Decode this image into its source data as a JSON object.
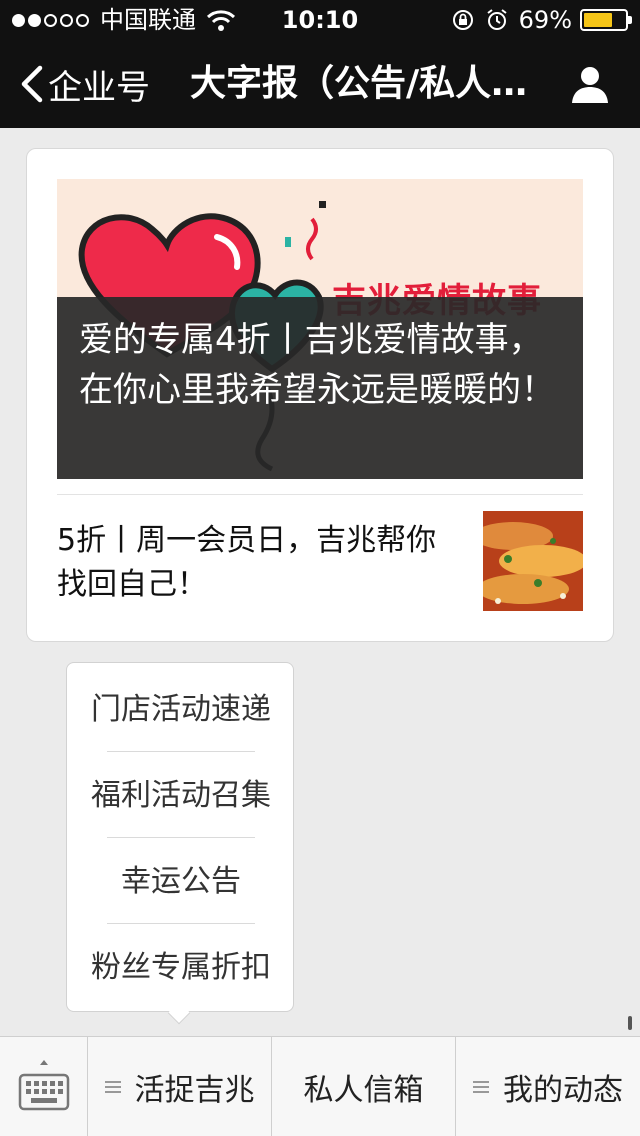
{
  "status_bar": {
    "carrier": "中国联通",
    "time": "10:10",
    "battery_percent_label": "69%",
    "battery_level": 0.69,
    "signal_bars_on": 2,
    "signal_bars_total": 5
  },
  "nav": {
    "back_label": "企业号",
    "title": "大字报（公告/私人…",
    "icons": {
      "back": "chevron-left-icon",
      "profile": "person-icon"
    }
  },
  "card": {
    "hero_brand": "吉兆爱情故事",
    "hero_title": "爱的专属4折丨吉兆爱情故事，在你心里我希望永远是暖暖的！",
    "sub_title": "5折丨周一会员日，吉兆帮你找回自己！"
  },
  "popup_menu": {
    "items": [
      "门店活动速递",
      "福利活动召集",
      "幸运公告",
      "粉丝专属折扣"
    ]
  },
  "bottom_menu": {
    "items": [
      {
        "label": "活捉吉兆",
        "has_submenu": true
      },
      {
        "label": "私人信箱",
        "has_submenu": false
      },
      {
        "label": "我的动态",
        "has_submenu": true
      }
    ]
  },
  "colors": {
    "header_bg": "#111111",
    "page_bg": "#ebebeb",
    "battery": "#f5c518",
    "brand_red": "#e21e3a"
  }
}
